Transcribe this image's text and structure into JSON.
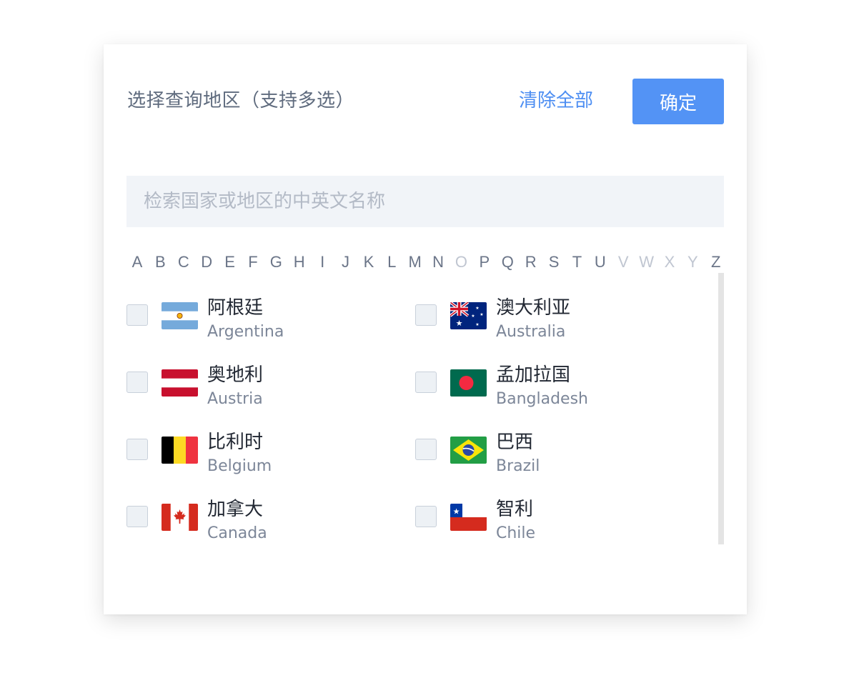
{
  "header": {
    "title": "选择查询地区（支持多选）",
    "clear_label": "清除全部",
    "confirm_label": "确定"
  },
  "search": {
    "placeholder": "检索国家或地区的中英文名称",
    "value": ""
  },
  "alphabet": [
    {
      "letter": "A",
      "enabled": true
    },
    {
      "letter": "B",
      "enabled": true
    },
    {
      "letter": "C",
      "enabled": true
    },
    {
      "letter": "D",
      "enabled": true
    },
    {
      "letter": "E",
      "enabled": true
    },
    {
      "letter": "F",
      "enabled": true
    },
    {
      "letter": "G",
      "enabled": true
    },
    {
      "letter": "H",
      "enabled": true
    },
    {
      "letter": "I",
      "enabled": true
    },
    {
      "letter": "J",
      "enabled": true
    },
    {
      "letter": "K",
      "enabled": true
    },
    {
      "letter": "L",
      "enabled": true
    },
    {
      "letter": "M",
      "enabled": true
    },
    {
      "letter": "N",
      "enabled": true
    },
    {
      "letter": "O",
      "enabled": false
    },
    {
      "letter": "P",
      "enabled": true
    },
    {
      "letter": "Q",
      "enabled": true
    },
    {
      "letter": "R",
      "enabled": true
    },
    {
      "letter": "S",
      "enabled": true
    },
    {
      "letter": "T",
      "enabled": true
    },
    {
      "letter": "U",
      "enabled": true
    },
    {
      "letter": "V",
      "enabled": false
    },
    {
      "letter": "W",
      "enabled": false
    },
    {
      "letter": "X",
      "enabled": false
    },
    {
      "letter": "Y",
      "enabled": false
    },
    {
      "letter": "Z",
      "enabled": true
    }
  ],
  "countries": [
    {
      "cn": "阿根廷",
      "en": "Argentina",
      "flag": "argentina-flag-icon",
      "checked": false
    },
    {
      "cn": "澳大利亚",
      "en": "Australia",
      "flag": "australia-flag-icon",
      "checked": false
    },
    {
      "cn": "奥地利",
      "en": "Austria",
      "flag": "austria-flag-icon",
      "checked": false
    },
    {
      "cn": "孟加拉国",
      "en": "Bangladesh",
      "flag": "bangladesh-flag-icon",
      "checked": false
    },
    {
      "cn": "比利时",
      "en": "Belgium",
      "flag": "belgium-flag-icon",
      "checked": false
    },
    {
      "cn": "巴西",
      "en": "Brazil",
      "flag": "brazil-flag-icon",
      "checked": false
    },
    {
      "cn": "加拿大",
      "en": "Canada",
      "flag": "canada-flag-icon",
      "checked": false
    },
    {
      "cn": "智利",
      "en": "Chile",
      "flag": "chile-flag-icon",
      "checked": false
    }
  ],
  "colors": {
    "accent": "#5393f5",
    "link": "#4d8ef2",
    "disabled_letter": "#c0c6d1"
  }
}
